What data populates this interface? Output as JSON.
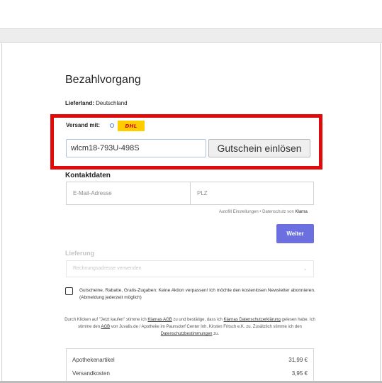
{
  "checkout": {
    "title": "Bezahlvorgang",
    "country_label": "Lieferland:",
    "country_value": "Deutschland",
    "shipping_label": "Versand mit:",
    "carrier": "DHL"
  },
  "coupon": {
    "value": "wlcm18-793U-498S",
    "button_label": "Gutschein einlösen"
  },
  "contact": {
    "title": "Kontaktdaten",
    "email_placeholder": "E-Mail-Adresse",
    "plz_placeholder": "PLZ",
    "autofill_text": "Autofill Einstellungen",
    "sep": " • ",
    "privacy_text": "Datenschutz von ",
    "klarna": "Klarna",
    "continue_label": "Weiter"
  },
  "delivery": {
    "title": "Lieferung",
    "select_value": "Rechnungsadresse verwenden"
  },
  "newsletter": {
    "text": "Gutscheine, Rabatte, Gratis-Zugaben: Keine Aktion verpassen! Ich möchte den kostenlosen Newsletter abonnieren. (Abmeldung jederzeit möglich)",
    "checked": false
  },
  "legal": {
    "part1": "Durch Klicken auf \"Jetzt kaufen\" stimme ich ",
    "link1": "Klarnas AGB",
    "part2": " zu und bestätige, dass ich ",
    "link2": "Klarnas Datenschutzerklärung",
    "part3": " gelesen habe. Ich stimme den ",
    "link3": "AGB",
    "part4": " von Juvalis.de / Apotheke im Paunsdorf Center Inh. Kirsten Fritsch e.K. zu. Zusätzlich stimme ich den ",
    "link4": "Datenschutzbestimmungen",
    "part5": " zu."
  },
  "summary": {
    "rows": [
      {
        "label": "Apothekenartikel",
        "value": "31,99 €"
      },
      {
        "label": "Versandkosten",
        "value": "3,95 €"
      }
    ]
  },
  "colors": {
    "highlight": "#e10a0a",
    "accent": "#6b6fe0",
    "dhl_yellow": "#ffcc00",
    "dhl_red": "#d40511"
  }
}
